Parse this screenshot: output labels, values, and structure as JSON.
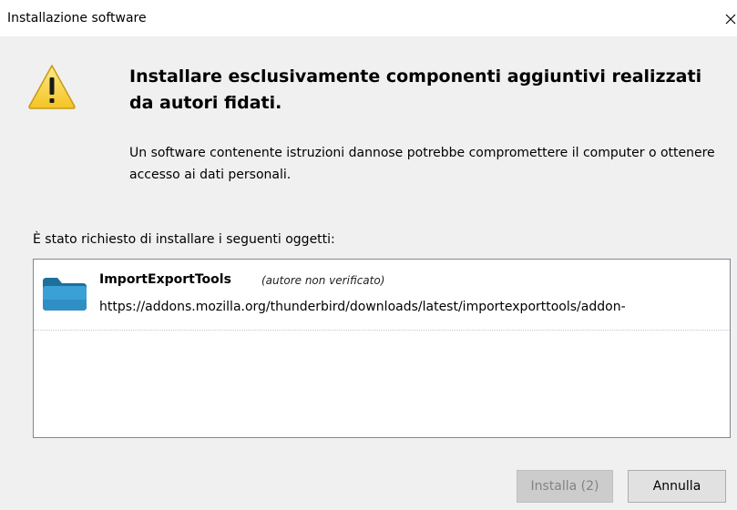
{
  "window": {
    "title": "Installazione software"
  },
  "warning": {
    "icon": "warning-triangle-icon",
    "heading": "Installare esclusivamente componenti aggiuntivi realizzati da autori fidati.",
    "description": "Un software contenente istruzioni dannose potrebbe compromettere il computer o ottenere accesso ai dati personali."
  },
  "install_list": {
    "label": "È stato richiesto di installare i seguenti oggetti:",
    "items": [
      {
        "icon": "folder-icon",
        "name": "ImportExportTools",
        "status": "(autore non verificato)",
        "url": "https://addons.mozilla.org/thunderbird/downloads/latest/importexporttools/addon-"
      }
    ]
  },
  "buttons": {
    "install": "Installa (2)",
    "cancel": "Annulla"
  },
  "colors": {
    "background": "#f0f0f0",
    "titlebar": "#ffffff",
    "warning_yellow": "#f7d13a",
    "folder_blue": "#2c8fc7",
    "disabled_button": "#cccccc"
  }
}
